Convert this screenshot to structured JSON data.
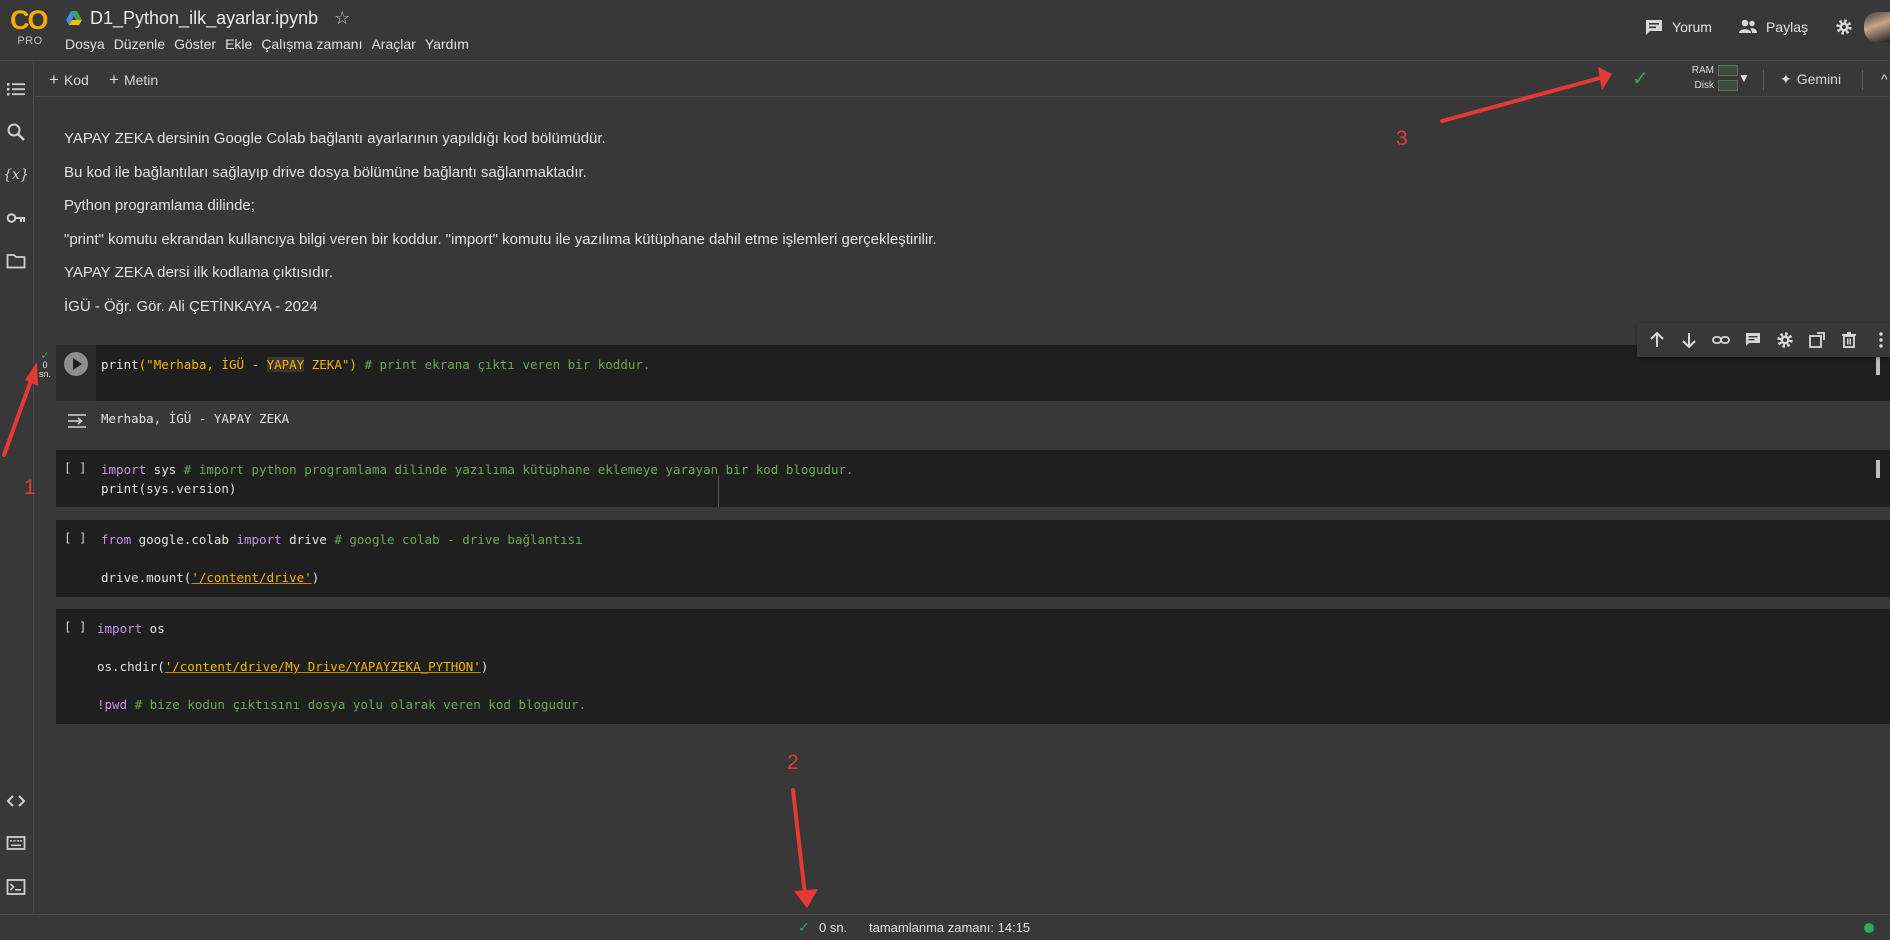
{
  "app": {
    "logo_text": "CO",
    "plan_badge": "PRO",
    "doc_title": "D1_Python_ilk_ayarlar.ipynb"
  },
  "menu": [
    "Dosya",
    "Düzenle",
    "Göster",
    "Ekle",
    "Çalışma zamanı",
    "Araçlar",
    "Yardım"
  ],
  "header_actions": {
    "comment_label": "Yorum",
    "share_label": "Paylaş"
  },
  "toolbar": {
    "add_code_label": "Kod",
    "add_text_label": "Metin",
    "ram_label": "RAM",
    "disk_label": "Disk",
    "gemini_label": "Gemini"
  },
  "text_cell": {
    "lines": [
      "YAPAY ZEKA dersinin Google Colab bağlantı ayarlarının yapıldığı kod bölümüdür.",
      "Bu kod ile bağlantıları sağlayıp drive dosya bölümüne bağlantı sağlanmaktadır.",
      "Python programlama dilinde;",
      "\"print\" komutu ekrandan kullancıya bilgi veren bir koddur. \"import\" komutu ile yazılıma kütüphane dahil etme işlemleri gerçekleştirilir.",
      "YAPAY ZEKA dersi ilk kodlama çıktısıdır.",
      "İGÜ - Öğr. Gör. Ali ÇETİNKAYA - 2024"
    ]
  },
  "cells": {
    "c1": {
      "fn": "print",
      "open": "(",
      "str_a": "\"Merhaba, İGÜ - ",
      "str_hl": "YAPAY",
      "str_b": " ZEKA\"",
      "close": ")",
      "comment": " # print ekrana çıktı veren bir koddur.",
      "exec_time": "0",
      "exec_unit": "sn.",
      "output": "Merhaba, İGÜ - YAPAY ZEKA"
    },
    "c2": {
      "brackets": "[ ]",
      "l1_kw": "import",
      "l1_rest": " sys ",
      "l1_comment": "# import python programlama dilinde yazılıma kütüphane eklemeye yarayan bir kod blogudur.",
      "l2": "print(sys.version)"
    },
    "c3": {
      "brackets": "[ ]",
      "kw_from": "from",
      "module": " google.colab ",
      "kw_import": "import",
      "name": " drive ",
      "comment": "# google colab - drive bağlantısı",
      "l2_a": "drive.mount(",
      "l2_str": "'/content/drive'",
      "l2_b": ")"
    },
    "c4": {
      "brackets": "[ ]",
      "kw_import": "import",
      "l1_rest": " os",
      "l2_a": "os.chdir(",
      "l2_str": "'/content/drive/My Drive/YAPAYZEKA_PYTHON'",
      "l2_b": ")",
      "l3_cmd": "!pwd",
      "l3_comment": " # bize kodun çıktısını dosya yolu olarak veren kod blogudur."
    }
  },
  "annotations": [
    "1",
    "2",
    "3"
  ],
  "status_bar": {
    "time": "0 sn.",
    "completion": "tamamlanma zamanı: 14:15"
  },
  "colors": {
    "accent_green": "#34a853",
    "annotation_red": "#e53935",
    "logo_orange": "#f9ab00"
  }
}
